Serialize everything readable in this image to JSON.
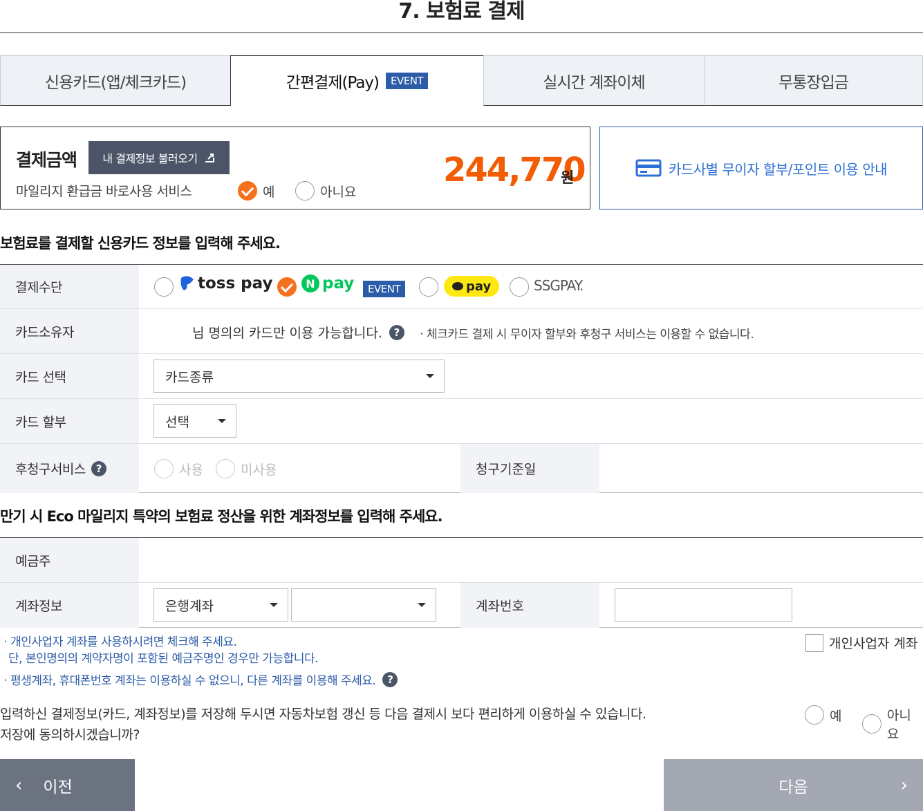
{
  "page_title": "7. 보험료 결제",
  "tabs": [
    {
      "label": "신용카드(앱/체크카드)"
    },
    {
      "label": "간편결제(Pay)",
      "badge": "EVENT"
    },
    {
      "label": "실시간 계좌이체"
    },
    {
      "label": "무통장입금"
    }
  ],
  "amount": {
    "label": "결제금액",
    "load_button": "내 결제정보 불러오기",
    "mileage_label": "마일리지 환급금 바로사용 서비스",
    "mileage_yes": "예",
    "mileage_no": "아니요",
    "value": "244,770",
    "unit": "원"
  },
  "card_guide": "카드사별 무이자 할부/포인트 이용 안내",
  "card_section": {
    "title": "보험료를 결제할 신용카드 정보를 입력해 주세요.",
    "payment_method_label": "결제수단",
    "pay_options": [
      {
        "name": "toss pay"
      },
      {
        "name": "pay",
        "badge": "EVENT"
      },
      {
        "name": "pay"
      },
      {
        "name": "SSGPAY."
      }
    ],
    "card_owner_label": "카드소유자",
    "card_owner_text": "님 명의의 카드만 이용 가능합니다.",
    "card_owner_note": "ㆍ체크카드 결제 시 무이자 할부와 후청구 서비스는 이용할 수 없습니다.",
    "card_select_label": "카드 선택",
    "card_select_value": "카드종류",
    "installment_label": "카드 할부",
    "installment_value": "선택",
    "post_billing_label": "후청구서비스",
    "post_billing_use": "사용",
    "post_billing_nouse": "미사용",
    "billing_date_label": "청구기준일"
  },
  "account_section": {
    "title": "만기 시 Eco 마일리지 특약의 보험료 정산을 위한 계좌정보를 입력해 주세요.",
    "holder_label": "예금주",
    "account_info_label": "계좌정보",
    "bank_select_value": "은행계좌",
    "account_number_label": "계좌번호",
    "note1_line1": "ㆍ개인사업자 계좌를 사용하시려면 체크해 주세요.",
    "note1_line2": "단, 본인명의의 계약자명이 포함된 예금주명인 경우만 가능합니다.",
    "note2": "ㆍ평생계좌, 휴대폰번호 계좌는 이용하실 수 없으니, 다른 계좌를 이용해 주세요.",
    "business_account_label": "개인사업자 계좌"
  },
  "consent": {
    "line1": "입력하신 결제정보(카드, 계좌정보)를 저장해 두시면 자동차보험 갱신 등 다음 결제시 보다 편리하게 이용하실 수 있습니다.",
    "line2": "저장에 동의하시겠습니까?",
    "yes": "예",
    "no": "아니요"
  },
  "nav": {
    "prev": "이전",
    "next": "다음"
  },
  "colors": {
    "accent_orange": "#f25c05",
    "brand_blue": "#2c5ba8"
  }
}
